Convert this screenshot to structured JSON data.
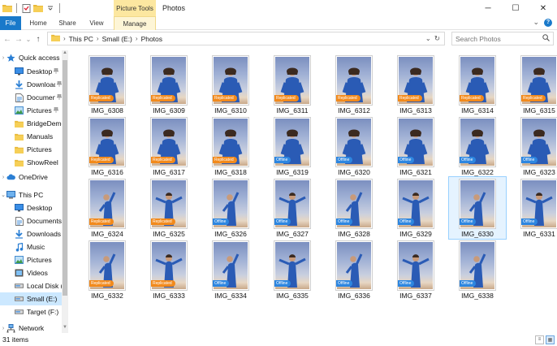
{
  "window": {
    "title": "Photos",
    "context_tab_group": "Picture Tools",
    "minimize": "─",
    "maximize": "☐",
    "close": "✕"
  },
  "ribbon": {
    "tabs": [
      {
        "label": "File"
      },
      {
        "label": "Home"
      },
      {
        "label": "Share"
      },
      {
        "label": "View"
      },
      {
        "label": "Manage"
      }
    ],
    "collapse_glyph": "⌄",
    "help_glyph": "?"
  },
  "address": {
    "back": "←",
    "forward": "→",
    "recent": "⌄",
    "up": "↑",
    "crumbs": [
      "This PC",
      "Small (E:)",
      "Photos"
    ],
    "separator": "›",
    "dropdown": "⌄",
    "refresh": "↻"
  },
  "search": {
    "placeholder": "Search Photos",
    "icon": "search-icon"
  },
  "nav": {
    "items": [
      {
        "label": "Quick access",
        "icon": "star-icon",
        "chevron": "›",
        "pinned": false
      },
      {
        "label": "Desktop",
        "icon": "desktop-icon",
        "pinned": true
      },
      {
        "label": "Downloads",
        "icon": "download-icon",
        "pinned": true
      },
      {
        "label": "Documents",
        "icon": "document-icon",
        "pinned": true
      },
      {
        "label": "Pictures",
        "icon": "pictures-icon",
        "pinned": true
      },
      {
        "label": "BridgeDemo",
        "icon": "folder-icon",
        "pinned": false
      },
      {
        "label": "Manuals",
        "icon": "folder-icon",
        "pinned": false
      },
      {
        "label": "Pictures",
        "icon": "folder-icon",
        "pinned": false
      },
      {
        "label": "ShowReel",
        "icon": "folder-icon",
        "pinned": false
      },
      {
        "label": "OneDrive",
        "icon": "cloud-icon",
        "chevron": "›",
        "pinned": false
      },
      {
        "label": "This PC",
        "icon": "computer-icon",
        "chevron": "⌄",
        "pinned": false
      },
      {
        "label": "Desktop",
        "icon": "desktop-icon",
        "pinned": false
      },
      {
        "label": "Documents",
        "icon": "document-icon",
        "pinned": false
      },
      {
        "label": "Downloads",
        "icon": "download-icon",
        "pinned": false
      },
      {
        "label": "Music",
        "icon": "music-icon",
        "pinned": false
      },
      {
        "label": "Pictures",
        "icon": "pictures-icon",
        "pinned": false
      },
      {
        "label": "Videos",
        "icon": "video-icon",
        "pinned": false
      },
      {
        "label": "Local Disk (C:)",
        "icon": "drive-icon",
        "pinned": false
      },
      {
        "label": "Small (E:)",
        "icon": "drive-icon",
        "pinned": false,
        "selected": true
      },
      {
        "label": "Target (F:)",
        "icon": "drive-icon",
        "pinned": false
      },
      {
        "label": "Network",
        "icon": "network-icon",
        "chevron": "›",
        "pinned": false
      }
    ],
    "pin_glyph": "📌"
  },
  "files": [
    {
      "name": "IMG_6308",
      "badge": "Replicated"
    },
    {
      "name": "IMG_6309",
      "badge": "Replicated"
    },
    {
      "name": "IMG_6310",
      "badge": "Replicated"
    },
    {
      "name": "IMG_6311",
      "badge": "Replicated"
    },
    {
      "name": "IMG_6312",
      "badge": "Replicated"
    },
    {
      "name": "IMG_6313",
      "badge": "Replicated"
    },
    {
      "name": "IMG_6314",
      "badge": "Replicated"
    },
    {
      "name": "IMG_6315",
      "badge": "Replicated"
    },
    {
      "name": "IMG_6316",
      "badge": "Replicated"
    },
    {
      "name": "IMG_6317",
      "badge": "Replicated"
    },
    {
      "name": "IMG_6318",
      "badge": "Replicated"
    },
    {
      "name": "IMG_6319",
      "badge": "Offline"
    },
    {
      "name": "IMG_6320",
      "badge": "Offline"
    },
    {
      "name": "IMG_6321",
      "badge": "Offline"
    },
    {
      "name": "IMG_6322",
      "badge": "Offline"
    },
    {
      "name": "IMG_6323",
      "badge": "Offline"
    },
    {
      "name": "IMG_6324",
      "badge": "Replicated"
    },
    {
      "name": "IMG_6325",
      "badge": "Replicated"
    },
    {
      "name": "IMG_6326",
      "badge": "Offline"
    },
    {
      "name": "IMG_6327",
      "badge": "Offline"
    },
    {
      "name": "IMG_6328",
      "badge": "Offline"
    },
    {
      "name": "IMG_6329",
      "badge": "Offline"
    },
    {
      "name": "IMG_6330",
      "badge": "Offline",
      "selected": true
    },
    {
      "name": "IMG_6331",
      "badge": "Offline"
    },
    {
      "name": "IMG_6332",
      "badge": "Replicated"
    },
    {
      "name": "IMG_6333",
      "badge": "Replicated"
    },
    {
      "name": "IMG_6334",
      "badge": "Offline"
    },
    {
      "name": "IMG_6335",
      "badge": "Offline"
    },
    {
      "name": "IMG_6336",
      "badge": "Offline"
    },
    {
      "name": "IMG_6337",
      "badge": "Offline"
    },
    {
      "name": "IMG_6338",
      "badge": "Offline"
    }
  ],
  "status": {
    "count": "31 items"
  },
  "colors": {
    "accent": "#1979ca",
    "replicated": "#f28a1c",
    "offline": "#2d86e0",
    "context_tab": "#fce7a0",
    "selection": "#cce8ff"
  }
}
